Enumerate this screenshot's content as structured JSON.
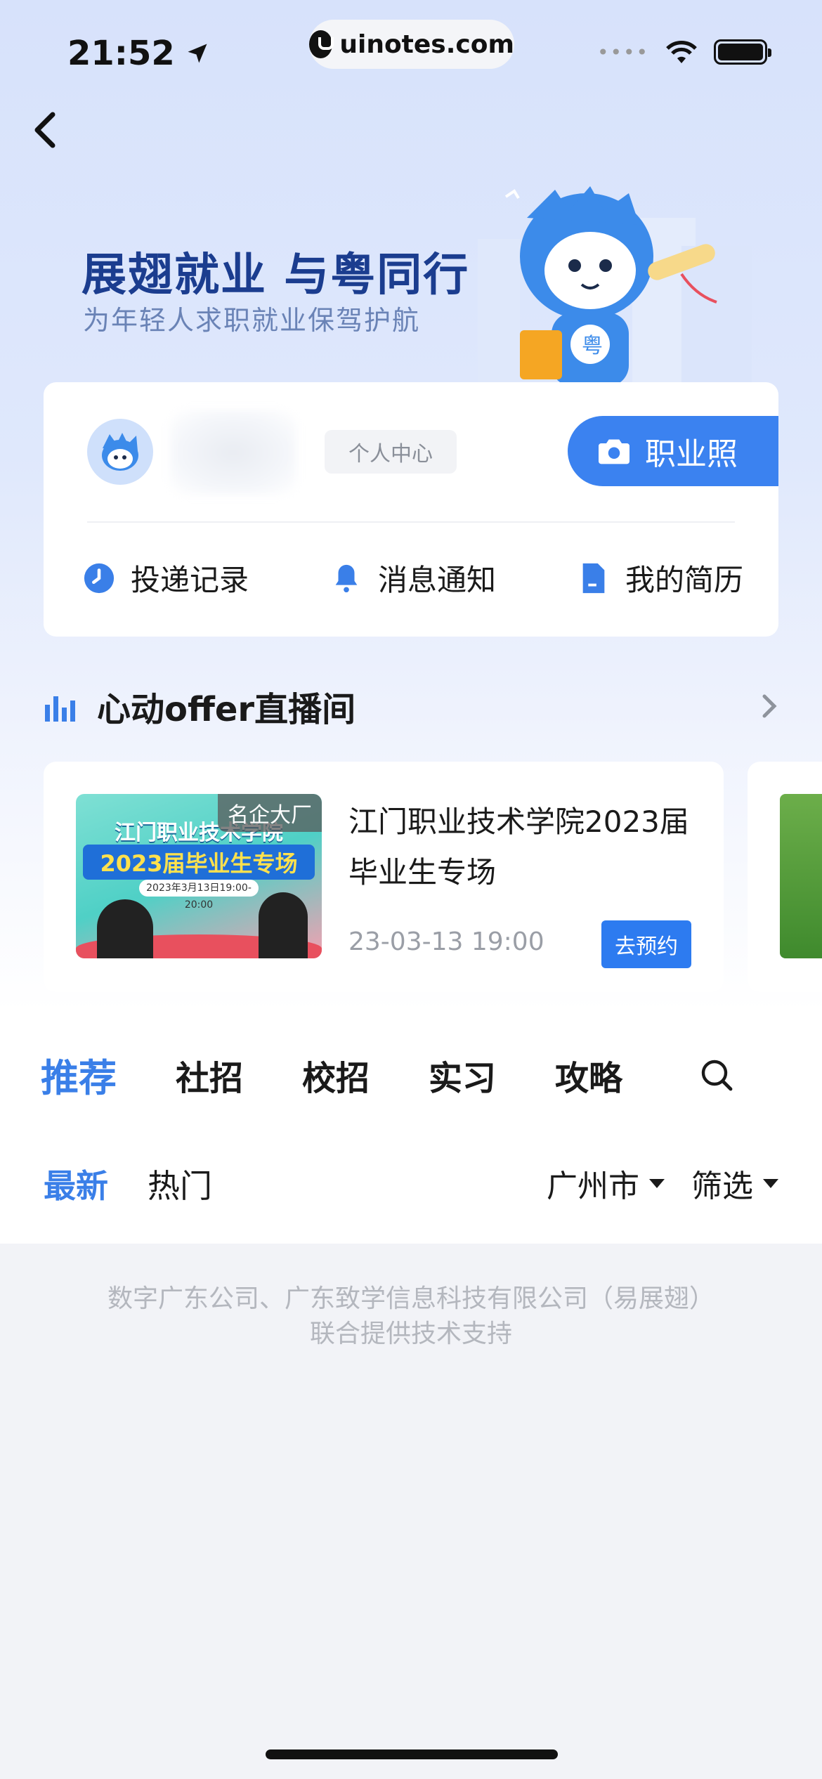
{
  "status": {
    "time": "21:52",
    "url": "uinotes.com"
  },
  "banner": {
    "title": "展翅就业 与粤同行",
    "subtitle": "为年轻人求职就业保驾护航"
  },
  "profile": {
    "personal_center": "个人中心",
    "photo_button": "职业照",
    "quick_links": [
      {
        "label": "投递记录",
        "icon": "clock-icon"
      },
      {
        "label": "消息通知",
        "icon": "bell-icon"
      },
      {
        "label": "我的简历",
        "icon": "document-icon"
      }
    ]
  },
  "live": {
    "title": "心动offer直播间",
    "card": {
      "tag": "名企大厂",
      "thumb_line1": "江门职业技术学院",
      "thumb_line2": "2023届毕业生专场",
      "thumb_date": "2023年3月13日19:00-20:00",
      "name": "江门职业技术学院2023届毕业生专场",
      "time": "23-03-13 19:00",
      "button": "去预约"
    }
  },
  "tabs": [
    "推荐",
    "社招",
    "校招",
    "实习",
    "攻略"
  ],
  "subtabs": [
    "最新",
    "热门"
  ],
  "filters": {
    "city": "广州市",
    "filter": "筛选"
  },
  "footer": {
    "line1": "数字广东公司、广东致学信息科技有限公司（易展翅）",
    "line2": "联合提供技术支持"
  },
  "colors": {
    "accent": "#3a7fe8",
    "button": "#2d7bf0",
    "banner_title": "#1b3d8f"
  }
}
